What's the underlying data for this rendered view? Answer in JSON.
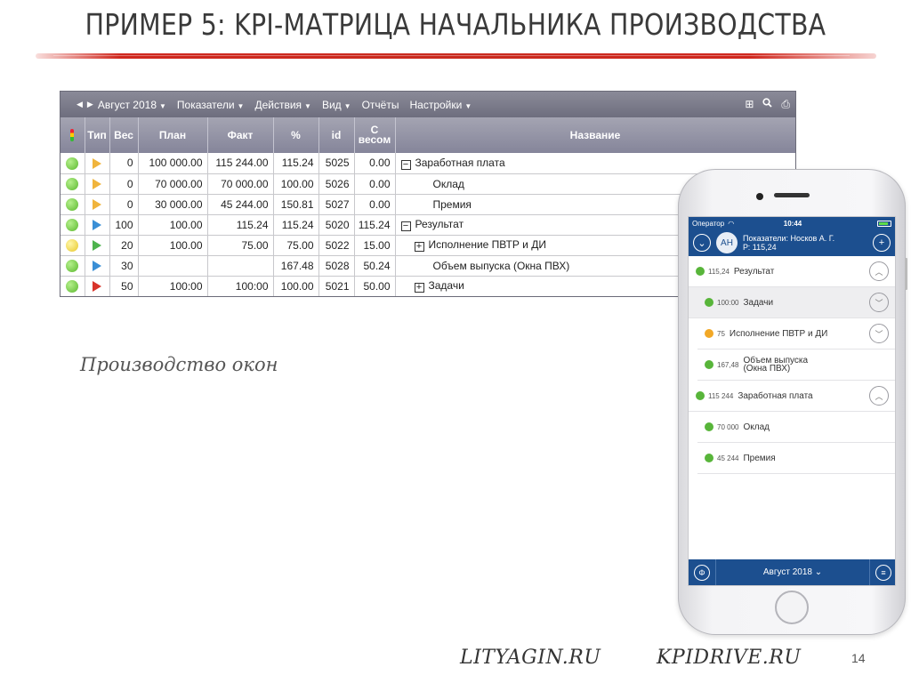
{
  "slide": {
    "title": "ПРИМЕР 5: KPI-МАТРИЦА НАЧАЛЬНИКА ПРОИЗВОДСТВА",
    "caption": "Производство окон",
    "footer_left": "LITYAGIN.RU",
    "footer_right": "KPIDRIVE.RU",
    "page_number": "14",
    "accent_color": "#d0281e"
  },
  "toolbar": {
    "period": "Август 2018",
    "menu_indicators": "Показатели",
    "menu_actions": "Действия",
    "menu_view": "Вид",
    "menu_reports": "Отчёты",
    "menu_settings": "Настройки",
    "icons": [
      "grid-icon",
      "search-icon",
      "print-icon"
    ]
  },
  "table": {
    "headers": {
      "type": "Тип",
      "weight": "Вес",
      "plan": "План",
      "fact": "Факт",
      "percent": "%",
      "id": "id",
      "weighted_top": "С",
      "weighted_bottom": "весом",
      "name": "Название"
    },
    "rows": [
      {
        "status": "green",
        "type": "yellow",
        "weight": "0",
        "plan": "100 000.00",
        "fact": "115 244.00",
        "percent": "115.24",
        "id": "5025",
        "weighted": "0.00",
        "name": "Заработная плата",
        "tree": "minus",
        "indent": 0
      },
      {
        "status": "green",
        "type": "yellow",
        "weight": "0",
        "plan": "70 000.00",
        "fact": "70 000.00",
        "percent": "100.00",
        "id": "5026",
        "weighted": "0.00",
        "name": "Оклад",
        "tree": "",
        "indent": 2
      },
      {
        "status": "green",
        "type": "yellow",
        "weight": "0",
        "plan": "30 000.00",
        "fact": "45 244.00",
        "percent": "150.81",
        "id": "5027",
        "weighted": "0.00",
        "name": "Премия",
        "tree": "",
        "indent": 2
      },
      {
        "status": "green",
        "type": "blue",
        "weight": "100",
        "plan": "100.00",
        "fact": "115.24",
        "percent": "115.24",
        "id": "5020",
        "weighted": "115.24",
        "name": "Результат",
        "tree": "minus",
        "indent": 0
      },
      {
        "status": "yellow",
        "type": "green",
        "weight": "20",
        "plan": "100.00",
        "fact": "75.00",
        "percent": "75.00",
        "id": "5022",
        "weighted": "15.00",
        "name": "Исполнение ПВТР и ДИ",
        "tree": "plus",
        "indent": 1
      },
      {
        "status": "green",
        "type": "blue",
        "weight": "30",
        "plan": "",
        "fact": "",
        "percent": "167.48",
        "id": "5028",
        "weighted": "50.24",
        "name": "Объем выпуска (Окна ПВХ)",
        "tree": "",
        "indent": 2
      },
      {
        "status": "green",
        "type": "red",
        "weight": "50",
        "plan": "100:00",
        "fact": "100:00",
        "percent": "100.00",
        "id": "5021",
        "weighted": "50.00",
        "name": "Задачи",
        "tree": "plus",
        "indent": 1
      }
    ]
  },
  "phone": {
    "carrier": "Оператор",
    "time": "10:44",
    "avatar_initials": "АН",
    "header_line1": "Показатели: Носков А. Г.",
    "header_line2": "Р: 115,24",
    "items": [
      {
        "dot": "green",
        "value": "115,24",
        "label": "Результат",
        "label2": "",
        "child": false,
        "shaded": false,
        "chevron": "up"
      },
      {
        "dot": "green",
        "value": "100:00",
        "label": "Задачи",
        "label2": "",
        "child": true,
        "shaded": true,
        "chevron": "down"
      },
      {
        "dot": "orange",
        "value": "75",
        "label": "Исполнение ПВТР и ДИ",
        "label2": "",
        "child": true,
        "shaded": false,
        "chevron": "down"
      },
      {
        "dot": "green",
        "value": "167,48",
        "label": "Объем выпуска",
        "label2": "(Окна ПВХ)",
        "child": true,
        "shaded": false,
        "chevron": ""
      },
      {
        "dot": "green",
        "value": "115 244",
        "label": "Заработная плата",
        "label2": "",
        "child": false,
        "shaded": false,
        "chevron": "up"
      },
      {
        "dot": "green",
        "value": "70 000",
        "label": "Оклад",
        "label2": "",
        "child": true,
        "shaded": false,
        "chevron": ""
      },
      {
        "dot": "green",
        "value": "45 244",
        "label": "Премия",
        "label2": "",
        "child": true,
        "shaded": false,
        "chevron": ""
      }
    ],
    "tab_period": "Август 2018 ⌄"
  }
}
